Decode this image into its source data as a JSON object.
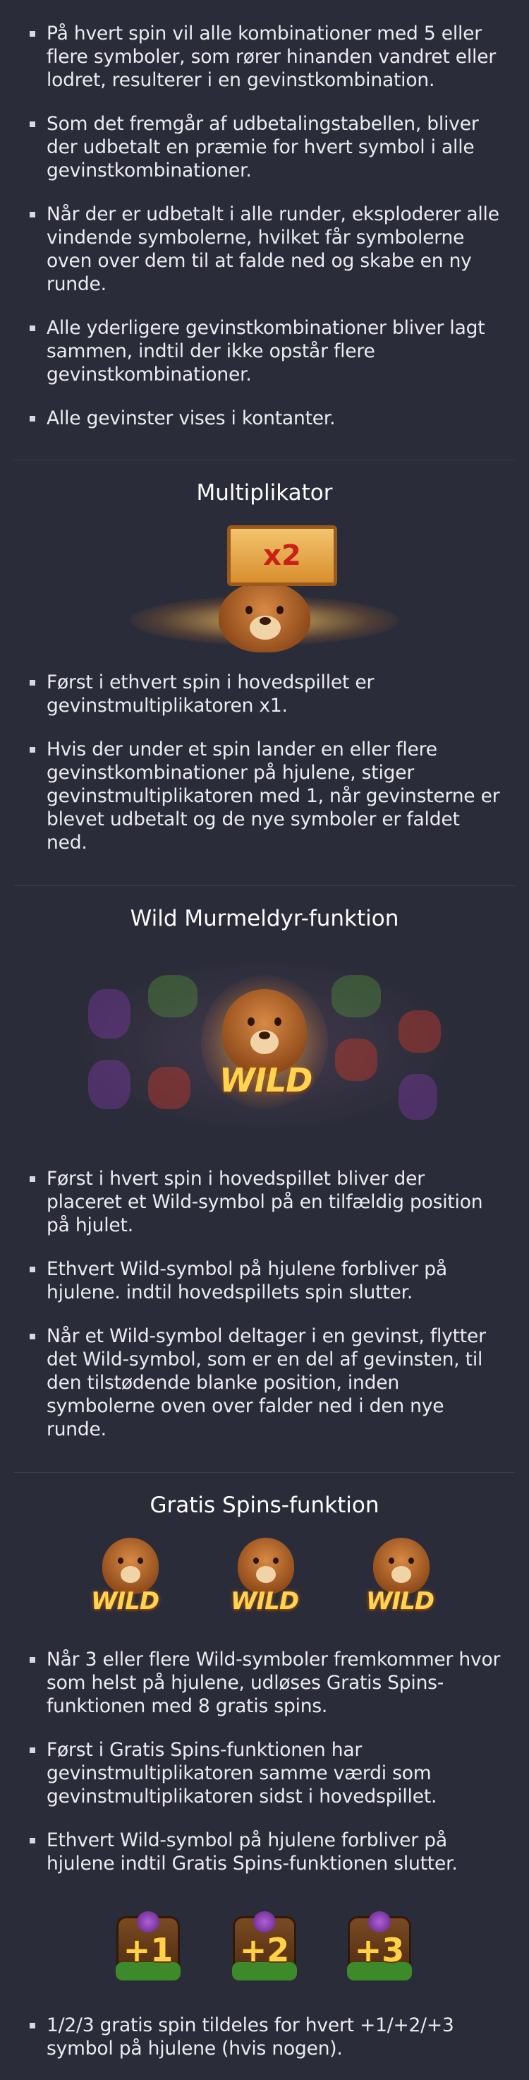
{
  "intro_rules": [
    "På hvert spin vil alle kombinationer med 5 eller flere symboler, som rører hinanden vandret eller lodret, resulterer i en gevinstkombination.",
    "Som det fremgår af udbetalingstabellen, bliver der udbetalt en præmie for hvert symbol i alle gevinstkombinationer.",
    "Når der er udbetalt i alle runder, eksploderer alle vindende symbolerne, hvilket får symbolerne oven over dem til at falde ned og skabe en ny runde.",
    "Alle yderligere gevinstkombinationer bliver lagt sammen, indtil der ikke opstår flere gevinstkombinationer.",
    "Alle gevinster vises i kontanter."
  ],
  "multiplier": {
    "title": "Multiplikator",
    "sign_text": "x2",
    "rules": [
      "Først i ethvert spin i hovedspillet er gevinstmultiplikatoren x1.",
      "Hvis der under et spin lander en eller flere gevinstkombinationer på hjulene, stiger gevinstmultiplikatoren med 1, når gevinsterne er blevet udbetalt og de nye symboler er faldet ned."
    ]
  },
  "wild": {
    "title": "Wild Murmeldyr-funktion",
    "symbol_text": "WILD",
    "rules": [
      "Først i hvert spin i hovedspillet bliver der placeret et Wild-symbol på en tilfældig position på hjulet.",
      "Ethvert Wild-symbol på hjulene forbliver på hjulene. indtil hovedspillets spin slutter.",
      "Når et Wild-symbol deltager i en gevinst, flytter det Wild-symbol, som er en del af gevinsten, til den tilstødende blanke position, inden symbolerne oven over falder ned i den nye runde."
    ]
  },
  "free_spins": {
    "title": "Gratis Spins-funktion",
    "wild_symbols": [
      "WILD",
      "WILD",
      "WILD"
    ],
    "rules": [
      "Når 3 eller flere Wild-symboler fremkommer hvor som helst på hjulene, udløses Gratis Spins-funktionen med 8 gratis spins.",
      "Først i Gratis Spins-funktionen har gevinstmultiplikatoren samme værdi som gevinstmultiplikatoren sidst i hovedspillet.",
      "Ethvert Wild-symbol på hjulene forbliver på hjulene indtil Gratis Spins-funktionen slutter."
    ],
    "plus_symbols": [
      "+1",
      "+2",
      "+3"
    ],
    "last_rules": [
      "1/2/3 gratis spin tildeles for hvert +1/+2/+3 symbol på hjulene (hvis nogen)."
    ]
  }
}
